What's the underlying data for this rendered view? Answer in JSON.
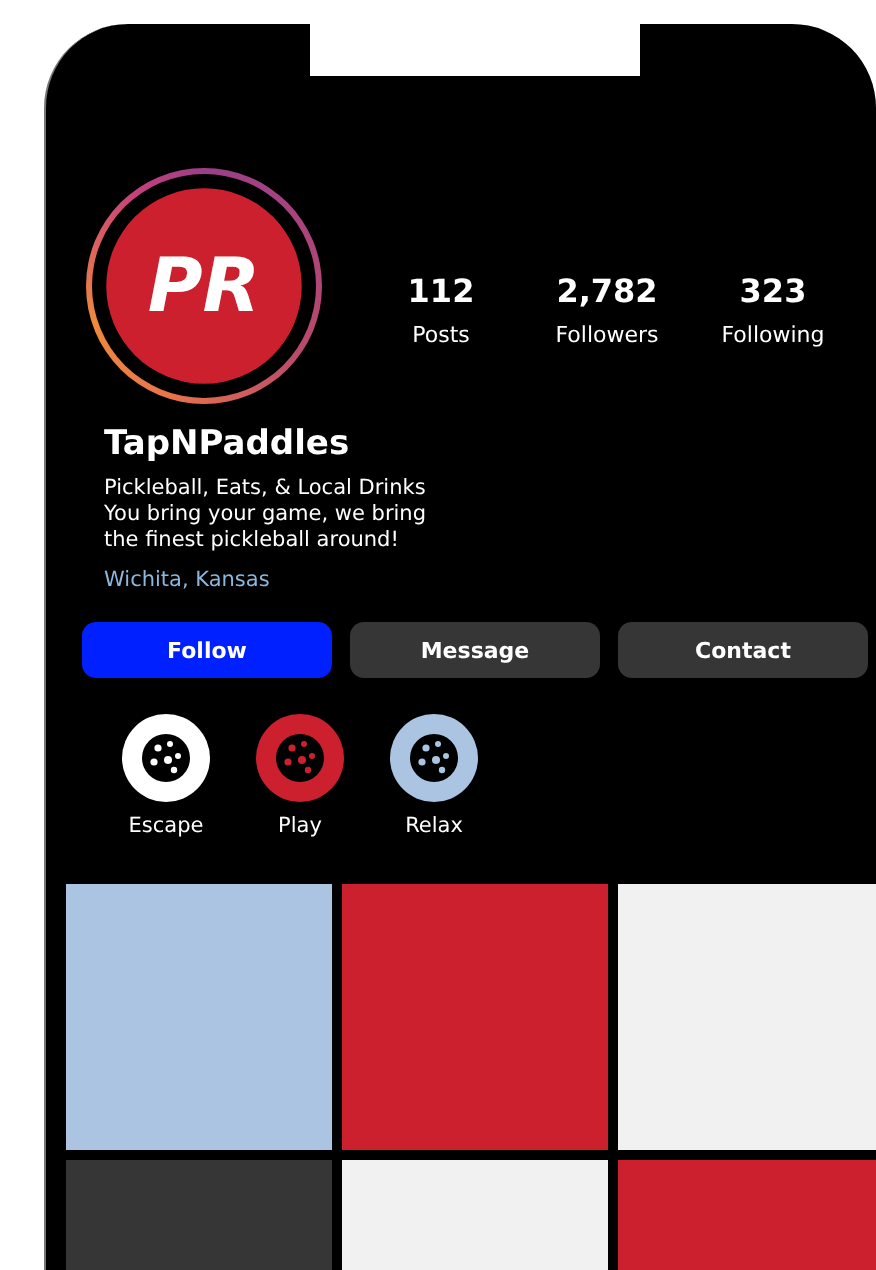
{
  "profile": {
    "avatar_text": "PR",
    "username": "TapNPaddles",
    "bio": [
      "Pickleball, Eats, & Local Drinks",
      "You bring your game, we bring",
      "the finest pickleball around!"
    ],
    "location": "Wichita, Kansas"
  },
  "stats": [
    {
      "value": "112",
      "label": "Posts"
    },
    {
      "value": "2,782",
      "label": "Followers"
    },
    {
      "value": "323",
      "label": "Following"
    }
  ],
  "buttons": [
    {
      "label": "Follow",
      "kind": "primary"
    },
    {
      "label": "Message",
      "kind": "secondary"
    },
    {
      "label": "Contact",
      "kind": "secondary"
    }
  ],
  "highlights": [
    {
      "label": "Escape",
      "color": "#ffffff"
    },
    {
      "label": "Play",
      "color": "#cd202f"
    },
    {
      "label": "Relax",
      "color": "#abc4e2"
    }
  ],
  "posts": [
    {
      "color": "#abc4e2"
    },
    {
      "color": "#cd202f"
    },
    {
      "color": "#f1f1f1"
    },
    {
      "color": "#363636"
    },
    {
      "color": "#f1f1f1"
    },
    {
      "color": "#cd202f"
    }
  ]
}
